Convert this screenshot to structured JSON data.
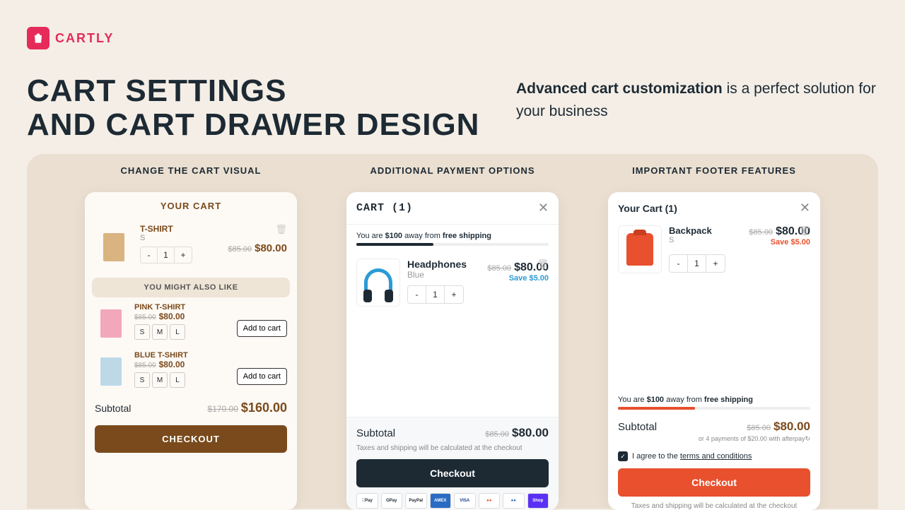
{
  "brand": {
    "name": "CARTLY"
  },
  "heading": "CART SETTINGS\nAND CART DRAWER DESIGN",
  "sub": {
    "bold": "Advanced cart customization",
    "rest": " is a perfect solution for your business"
  },
  "columns": {
    "c1": "CHANGE THE CART VISUAL",
    "c2": "ADDITIONAL PAYMENT OPTIONS",
    "c3": "IMPORTANT FOOTER FEATURES"
  },
  "card1": {
    "title": "YOUR CART",
    "item": {
      "name": "T-SHIRT",
      "variant": "S",
      "qminus": "-",
      "qval": "1",
      "qplus": "+",
      "old": "$85.00",
      "price": "$80.00"
    },
    "also": "YOU MIGHT ALSO LIKE",
    "rec1": {
      "name": "PINK T-SHIRT",
      "old": "$85.00",
      "price": "$80.00",
      "s": "S",
      "m": "M",
      "l": "L",
      "add": "Add to cart"
    },
    "rec2": {
      "name": "BLUE T-SHIRT",
      "old": "$85.00",
      "price": "$80.00",
      "s": "S",
      "m": "M",
      "l": "L",
      "add": "Add to cart"
    },
    "subtotal": {
      "label": "Subtotal",
      "old": "$170.00",
      "price": "$160.00"
    },
    "checkout": "CHECKOUT"
  },
  "card2": {
    "title": "CART (1)",
    "ship": {
      "p1": "You are ",
      "amt": "$100",
      "p2": " away from ",
      "p3": "free shipping"
    },
    "item": {
      "name": "Headphones",
      "variant": "Blue",
      "qminus": "-",
      "qval": "1",
      "qplus": "+",
      "old": "$85.00",
      "price": "$80.00",
      "save": "Save $5.00"
    },
    "subtotal": {
      "label": "Subtotal",
      "old": "$85.00",
      "price": "$80.00"
    },
    "tax": "Taxes and shipping will be calculated at the checkout",
    "checkout": "Checkout",
    "pay": {
      "p1": "Pay",
      "p2": "GPay",
      "p3": "PayPal",
      "p4": "AMEX",
      "p5": "VISA",
      "p6": "●●",
      "p7": "●●",
      "p8": "Shop"
    }
  },
  "card3": {
    "title": "Your Cart (1)",
    "item": {
      "name": "Backpack",
      "variant": "S",
      "qminus": "-",
      "qval": "1",
      "qplus": "+",
      "old": "$85.00",
      "price": "$80.00",
      "save": "Save $5.00"
    },
    "ship": {
      "p1": "You are ",
      "amt": "$100",
      "p2": " away from ",
      "p3": "free shipping"
    },
    "subtotal": {
      "label": "Subtotal",
      "old": "$85.00",
      "price": "$80.00"
    },
    "afterpay": "or 4 payments of $20.00 with afterpay↻",
    "agree": {
      "text": "I agree to the ",
      "link": "terms and conditions"
    },
    "checkout": "Checkout",
    "tax": "Taxes and shipping will be calculated at the checkout"
  }
}
